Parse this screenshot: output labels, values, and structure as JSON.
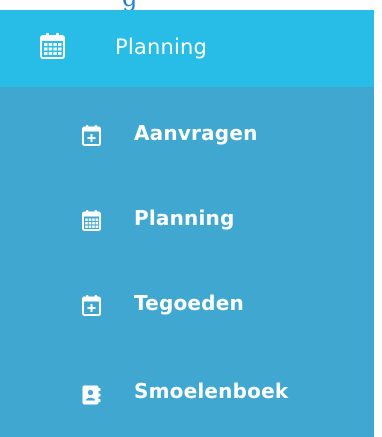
{
  "menu": {
    "header": {
      "label": "Planning",
      "icon": "calendar-grid-icon",
      "color": "#27bde6"
    },
    "items": [
      {
        "label": "Aanvragen",
        "icon": "calendar-plus-icon"
      },
      {
        "label": "Planning",
        "icon": "calendar-grid-icon"
      },
      {
        "label": "Tegoeden",
        "icon": "calendar-plus-icon"
      },
      {
        "label": "Smoelenboek",
        "icon": "contact-book-icon"
      }
    ],
    "background_color": "#3fa7d0",
    "text_color": "#ffffff"
  }
}
